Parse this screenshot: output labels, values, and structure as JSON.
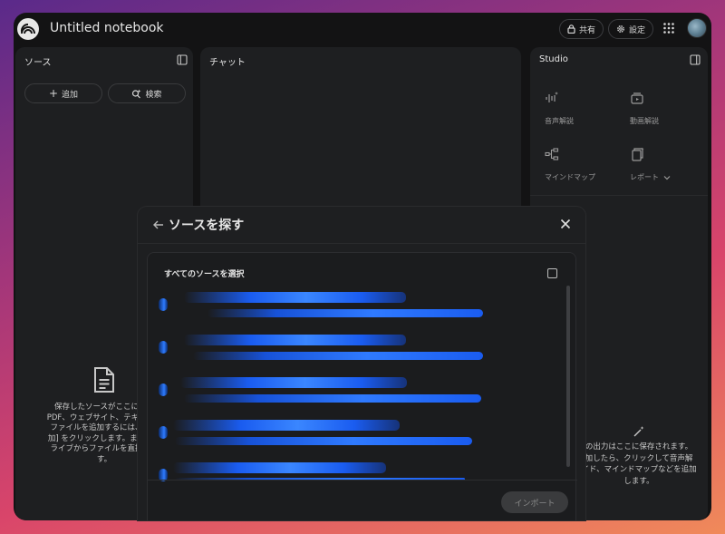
{
  "app": {
    "title": "Untitled notebook"
  },
  "header": {
    "share_label": "共有",
    "settings_label": "設定"
  },
  "sources": {
    "title": "ソース",
    "add_label": "追加",
    "search_label": "検索",
    "empty_lines": [
      "保存したソースがここに表示",
      "PDF、ウェブサイト、テキスト、",
      "ファイルを追加するには、上の",
      "加] をクリックします。または、",
      "ライブからファイルを直接イン",
      "す。"
    ]
  },
  "chat": {
    "title": "チャット"
  },
  "studio": {
    "title": "Studio",
    "tiles": [
      "音声解説",
      "動画解説",
      "マインドマップ",
      "レポート"
    ],
    "empty_lines": [
      "の出力はここに保存されます。",
      "加したら、クリックして音声解",
      "イド、マインドマップなどを追加",
      "します。"
    ]
  },
  "modal": {
    "title": "ソースを探す",
    "select_all_label": "すべてのソースを選択",
    "import_label": "インポート"
  }
}
